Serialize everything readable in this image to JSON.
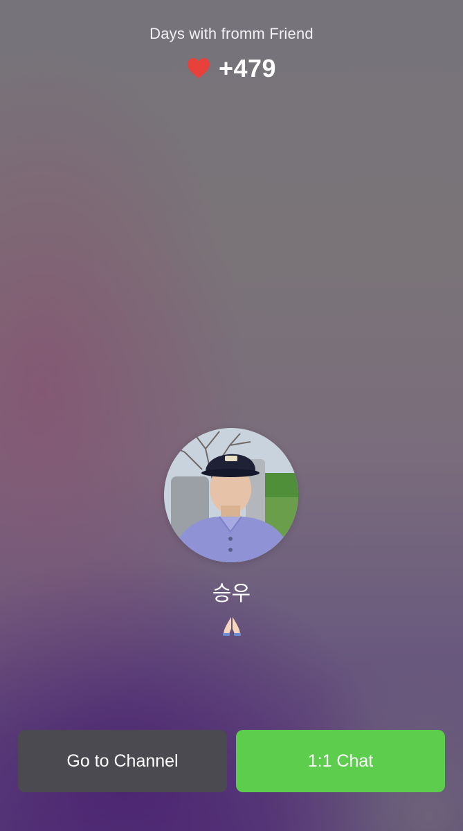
{
  "header": {
    "label": "Days with fromm Friend",
    "days_count": "+479",
    "heart_icon": "heart-icon",
    "heart_color": "#e8413c"
  },
  "profile": {
    "name": "승우",
    "status_icon": "folded-hands-icon"
  },
  "actions": {
    "channel_label": "Go to Channel",
    "chat_label": "1:1 Chat",
    "channel_color": "#4b4a51",
    "chat_color": "#5ccd4c"
  }
}
